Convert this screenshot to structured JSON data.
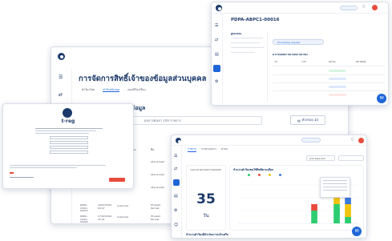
{
  "main_window": {
    "title": "การจัดการสิทธิ์เจ้าของข้อมูลส่วนบุคคล",
    "tabs": [
      "คำร้องใหม่",
      "คำร้องทั้งหมด",
      "ตอนนี้ร้องเรียน"
    ],
    "section_title": "ของข้อมูล",
    "search_placeholder": "ผลการค้นหา 109 รายการ",
    "filter_button": "ตัวกรอง 10",
    "columns": [
      "ประเภท",
      "ผู้ร้อง",
      "ชื่อ"
    ],
    "rows": [
      {
        "id": "RDPA-CUSO-00019",
        "date": "18/07/2024 09:07",
        "type": "Customer",
        "name": "Phuwish Parinat"
      },
      {
        "id": "RDPA-CUSO-00026",
        "date": "17/07/2024 15:31",
        "type": "Customer",
        "name": "Phuwish Parinat"
      }
    ],
    "cell_sample": "site.receipt"
  },
  "consent_window": {
    "brand": "t-reg",
    "footer_text": "t-reg"
  },
  "detail_window": {
    "title": "PDPA-ABPC1-00016",
    "sub_title": "ผู้ร้องเรียน",
    "status_chip": "Processing request",
    "section": "ตารางบันทึกการดำเนินการคำร้อง",
    "columns": [
      "วัน",
      "เวลา",
      "สถานะ",
      "หมายเหตุ"
    ]
  },
  "dashboard_window": {
    "tabs": [
      "ภาพรวม",
      "การดำเนินการ",
      "คำร้อง"
    ],
    "select_label": "Add Selected",
    "kpi_title": "ระยะเวลาดำเนินการโดยเฉลี่ย",
    "kpi_value": "35",
    "kpi_unit": "วัน",
    "chart_title": "จำนวนคำร้องขอใช้สิทธิ์ตามเดือน",
    "bottom_caption": "จำนวนคำร้องที่ดำเนินการแล้วเสร็จ"
  },
  "colors": {
    "brand_navy": "#1b3a6b",
    "accent_blue": "#1e66d8",
    "chart_green": "#2ecc71",
    "chart_red": "#e74c3c",
    "chart_yellow": "#f1c40f",
    "chart_blue": "#3b7be0"
  },
  "chart_data": {
    "type": "bar",
    "categories": [
      "1",
      "2",
      "3",
      "4",
      "5",
      "6",
      "7",
      "8",
      "9",
      "10"
    ],
    "series": [
      {
        "values": [
          0,
          0,
          0,
          0,
          0,
          0,
          2,
          0,
          3,
          1
        ]
      },
      {
        "values": [
          0,
          0,
          0,
          0,
          0,
          0,
          1,
          0,
          0,
          0
        ]
      },
      {
        "values": [
          0,
          0,
          0,
          0,
          0,
          0,
          0,
          0,
          1,
          2
        ]
      },
      {
        "values": [
          0,
          0,
          0,
          0,
          0,
          0,
          0,
          0,
          0,
          1
        ]
      }
    ]
  }
}
